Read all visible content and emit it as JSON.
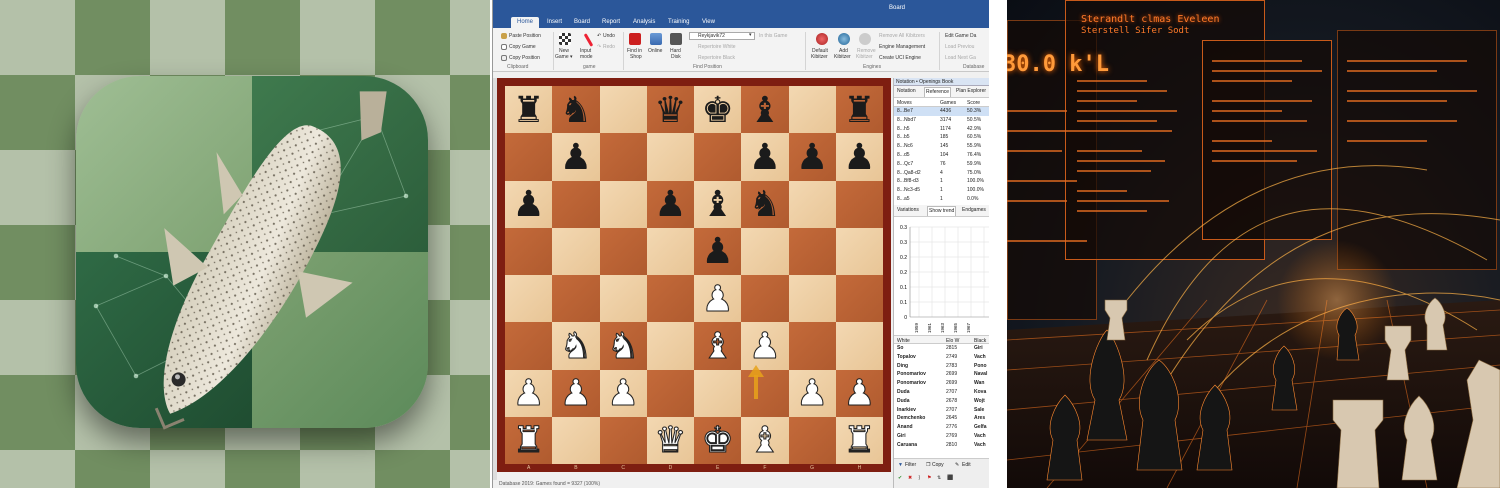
{
  "window": {
    "title": "Board"
  },
  "menu_tabs": [
    {
      "label": "Home",
      "active": true
    },
    {
      "label": "Insert"
    },
    {
      "label": "Board"
    },
    {
      "label": "Report"
    },
    {
      "label": "Analysis"
    },
    {
      "label": "Training"
    },
    {
      "label": "View"
    }
  ],
  "ribbon": {
    "clipboard": {
      "paste": "Paste Position",
      "copy_game": "Copy Game",
      "copy_position": "Copy Position",
      "group": "Clipboard"
    },
    "game": {
      "new": "New",
      "new2": "Game ▾",
      "input": "Input",
      "input2": "mode",
      "undo": "Undo",
      "redo": "Redo",
      "group": "game"
    },
    "find": {
      "shop": "Find in",
      "shop2": "Shop",
      "online": "Online",
      "hard": "Hard",
      "hard2": "Disk",
      "dropdown": "Reykjavik72",
      "in_this_game": "In this Game",
      "rep_white": "Repertoire White",
      "rep_black": "Repertoire Black",
      "group": "Find Position"
    },
    "engines": {
      "default": "Default",
      "default2": "Kibitzer",
      "add": "Add",
      "add2": "Kibitzer",
      "remove": "Remove",
      "remove2": "Kibitzer",
      "remove_all": "Remove All Kibitzers",
      "manage": "Engine Management",
      "uci": "Create UCI Engine",
      "group": "Engines"
    },
    "database": {
      "edit": "Edit Game Da",
      "load_prev": "Load Previou",
      "load_next": "Load Next Ga",
      "group": "Database"
    }
  },
  "board": {
    "files": [
      "A",
      "B",
      "C",
      "D",
      "E",
      "F",
      "G",
      "H"
    ],
    "ranks": [
      [
        "r",
        "n",
        "",
        "q",
        "k",
        "b",
        "",
        "r"
      ],
      [
        "",
        "p",
        "",
        "",
        "",
        "p",
        "p",
        "p"
      ],
      [
        "p",
        "",
        "",
        "p",
        "b",
        "n",
        "",
        ""
      ],
      [
        "",
        "",
        "",
        "",
        "p",
        "",
        "",
        ""
      ],
      [
        "",
        "",
        "",
        "",
        "P",
        "",
        "",
        ""
      ],
      [
        "",
        "N",
        "N",
        "",
        "B",
        "P",
        "",
        ""
      ],
      [
        "P",
        "P",
        "P",
        "",
        "",
        "",
        "P",
        "P"
      ],
      [
        "R",
        "",
        "",
        "Q",
        "K",
        "B",
        "",
        "R"
      ]
    ]
  },
  "notation": {
    "header": "Notation • Openings Book",
    "tabs": [
      "Notation",
      "Reference",
      "Plan Explorer"
    ],
    "columns": [
      "Moves",
      "Games",
      "Score"
    ],
    "rows": [
      {
        "move": "8...Be7",
        "games": "4436",
        "score": "50.3%"
      },
      {
        "move": "8...Nbd7",
        "games": "3174",
        "score": "50.5%"
      },
      {
        "move": "8...h5",
        "games": "1174",
        "score": "42.9%"
      },
      {
        "move": "8...b5",
        "games": "185",
        "score": "60.5%"
      },
      {
        "move": "8...Nc6",
        "games": "145",
        "score": "55.9%"
      },
      {
        "move": "8...d5",
        "games": "104",
        "score": "76.4%"
      },
      {
        "move": "8...Qc7",
        "games": "76",
        "score": "59.9%"
      },
      {
        "move": "8...Qa8-d2",
        "games": "4",
        "score": "75.0%"
      },
      {
        "move": "8...Bf8-d3",
        "games": "1",
        "score": "100.0%"
      },
      {
        "move": "8...Nc3-d5",
        "games": "1",
        "score": "100.0%"
      },
      {
        "move": "8...a5",
        "games": "1",
        "score": "0.0%"
      }
    ]
  },
  "trend": {
    "tabs": [
      "Variations",
      "Show trend",
      "Endgames"
    ],
    "yticks": [
      "0.3",
      "0.3",
      "0.2",
      "0.2",
      "0.1",
      "0.1",
      "0"
    ],
    "xticks": [
      "1959",
      "1961",
      "1963",
      "1965",
      "1967"
    ]
  },
  "players": {
    "columns": [
      "White",
      "Elo W",
      "Black"
    ],
    "rows": [
      {
        "white": "So",
        "elo": "2815",
        "black": "Giri"
      },
      {
        "white": "Topalov",
        "elo": "2749",
        "black": "Vach"
      },
      {
        "white": "Ding",
        "elo": "2783",
        "black": "Pono"
      },
      {
        "white": "Ponomariov",
        "elo": "2699",
        "black": "Naval"
      },
      {
        "white": "Ponomariov",
        "elo": "2699",
        "black": "Wan"
      },
      {
        "white": "Duda",
        "elo": "2707",
        "black": "Kova"
      },
      {
        "white": "Duda",
        "elo": "2678",
        "black": "Wojt"
      },
      {
        "white": "Inarkiev",
        "elo": "2707",
        "black": "Sale"
      },
      {
        "white": "Demchenko",
        "elo": "2645",
        "black": "Ares"
      },
      {
        "white": "Anand",
        "elo": "2776",
        "black": "Gelfa"
      },
      {
        "white": "Giri",
        "elo": "2769",
        "black": "Vach"
      },
      {
        "white": "Caruana",
        "elo": "2810",
        "black": "Vach"
      }
    ]
  },
  "footer": {
    "filter": "Filter",
    "copy": "Copy",
    "edit": "Edit"
  },
  "status": "Database 2019: Games found = 9327 (100%)",
  "right_screen": {
    "big_value": "30.0 k'L",
    "title": "Sterandlt clmas Eveleen",
    "subtitle": "Sterstell Sifer Sodt"
  }
}
